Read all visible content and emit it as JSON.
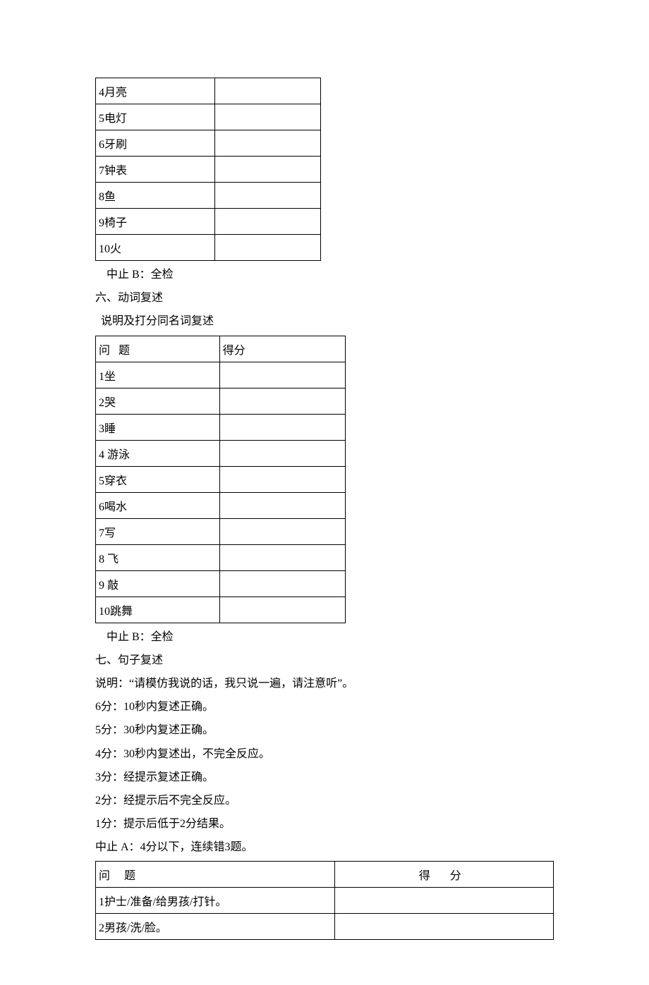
{
  "table1": {
    "rows": [
      {
        "label": "4月亮",
        "score": ""
      },
      {
        "label": "5电灯",
        "score": ""
      },
      {
        "label": "6牙刷",
        "score": ""
      },
      {
        "label": "7钟表",
        "score": ""
      },
      {
        "label": "8鱼",
        "score": ""
      },
      {
        "label": "9椅子",
        "score": ""
      },
      {
        "label": "10火",
        "score": ""
      }
    ]
  },
  "stop_b_1": "中止 B：全检",
  "section6": {
    "title": "六、动词复述",
    "note": "说明及打分同名词复述",
    "head_q": "问   题",
    "head_s": "得分",
    "rows": [
      {
        "label": "1坐",
        "score": ""
      },
      {
        "label": "2哭",
        "score": ""
      },
      {
        "label": "3睡",
        "score": ""
      },
      {
        "label": "4 游泳",
        "score": ""
      },
      {
        "label": "5穿衣",
        "score": ""
      },
      {
        "label": "6喝水",
        "score": ""
      },
      {
        "label": "7写",
        "score": ""
      },
      {
        "label": "8 飞",
        "score": ""
      },
      {
        "label": "9 敲",
        "score": ""
      },
      {
        "label": "10跳舞",
        "score": ""
      }
    ]
  },
  "stop_b_2": "中止 B：全检",
  "section7": {
    "title": "七、句子复述",
    "instruction": "说明：“请模仿我说的话，我只说一遍，请注意听”。",
    "criteria": [
      "6分：10秒内复述正确。",
      "5分：30秒内复述正确。",
      "4分：30秒内复述出，不完全反应。",
      "3分：经提示复述正确。",
      "2分：经提示后不完全反应。",
      "1分：提示后低于2分结果。",
      "中止 A：4分以下，连续错3题。"
    ],
    "head_q": "问     题",
    "head_s": "得   分",
    "rows": [
      {
        "label": "1护士/准备/给男孩/打针。",
        "score": ""
      },
      {
        "label": "2男孩/洗/脸。",
        "score": ""
      }
    ]
  }
}
